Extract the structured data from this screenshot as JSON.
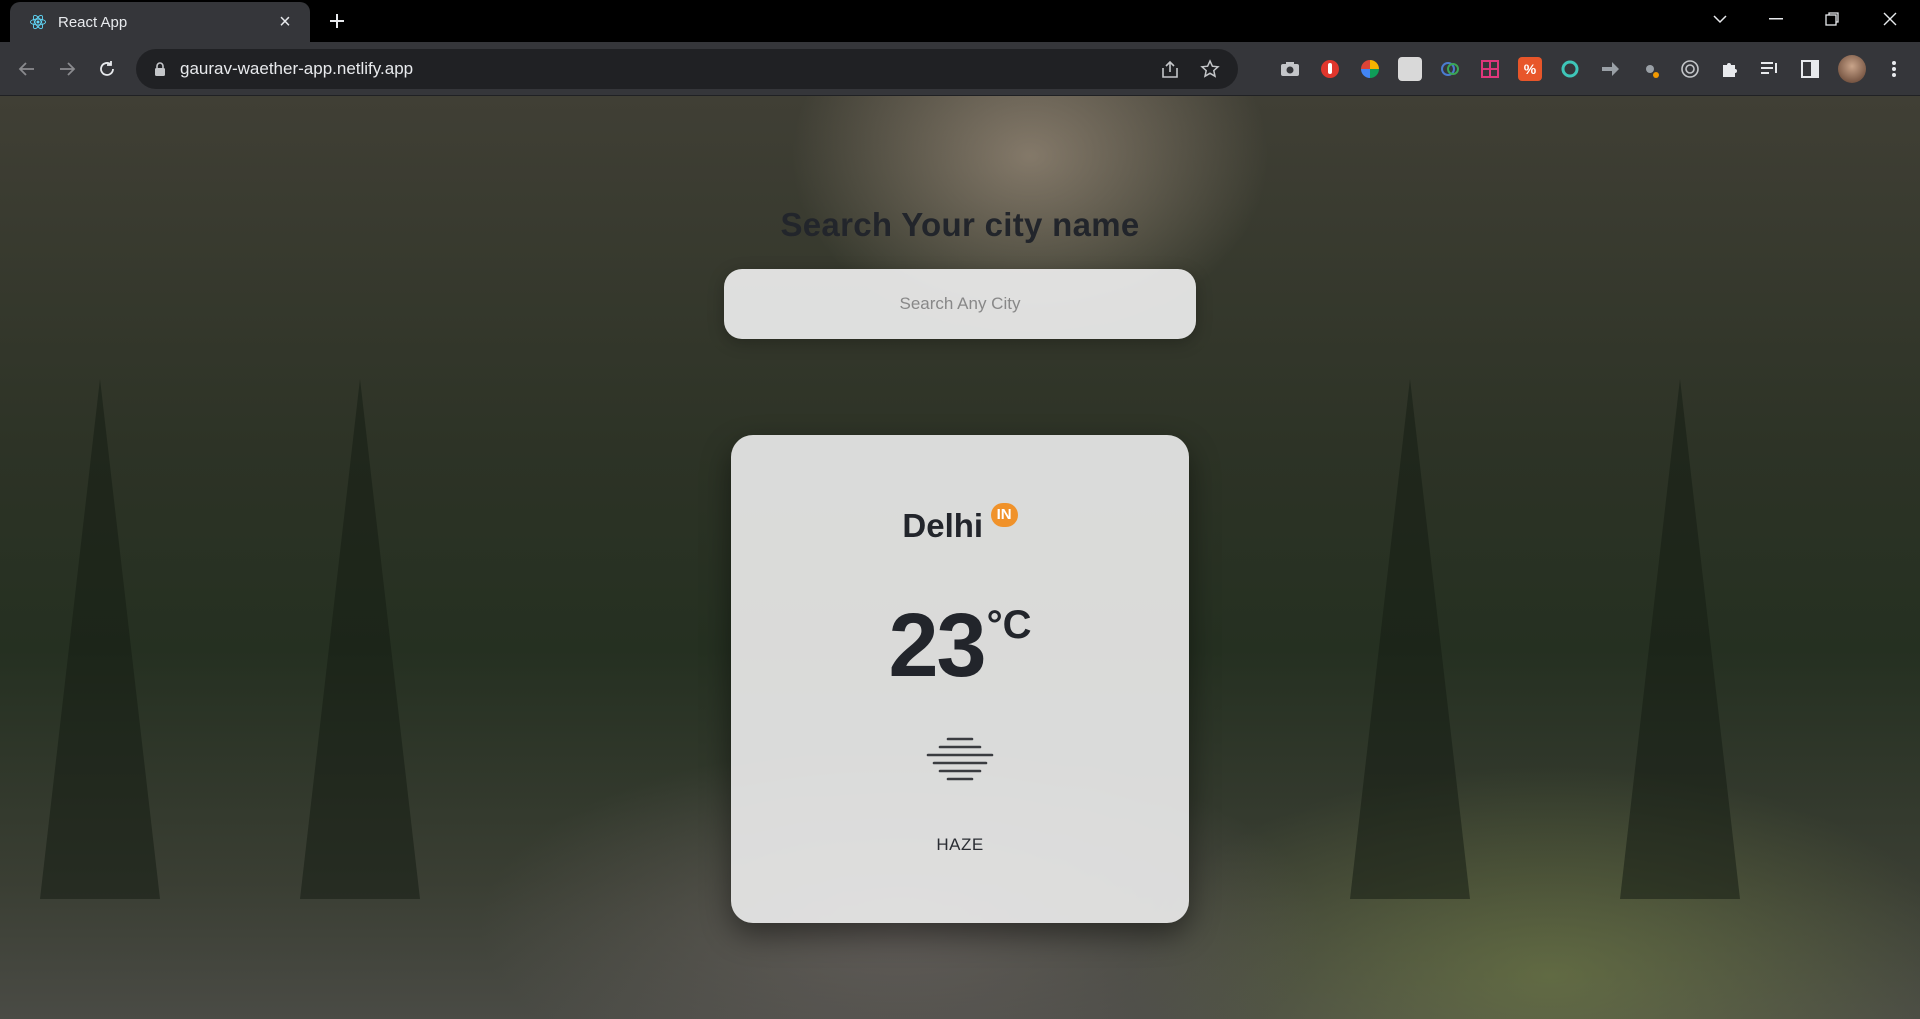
{
  "browser": {
    "tab": {
      "title": "React App",
      "favicon": "react-icon"
    },
    "address": {
      "url": "gaurav-waether-app.netlify.app"
    },
    "extensions": [
      "camera-icon",
      "shield-icon",
      "colorwheel-icon",
      "puzzle-book-icon",
      "chart-icon",
      "grid-icon",
      "percent-icon",
      "circle-icon",
      "arrow-icon",
      "clover-icon",
      "target-icon",
      "puzzle-icon",
      "reading-list-icon",
      "sidepanel-icon",
      "avatar-icon",
      "menu-icon"
    ]
  },
  "page": {
    "heading": "Search Your city name",
    "search": {
      "placeholder": "Search Any City",
      "value": ""
    },
    "weather": {
      "city": "Delhi",
      "country": "IN",
      "temperature": "23",
      "unit": "°C",
      "condition": "HAZE",
      "icon": "haze-icon"
    }
  },
  "colors": {
    "badge": "#f0922a",
    "text": "#22252b"
  }
}
